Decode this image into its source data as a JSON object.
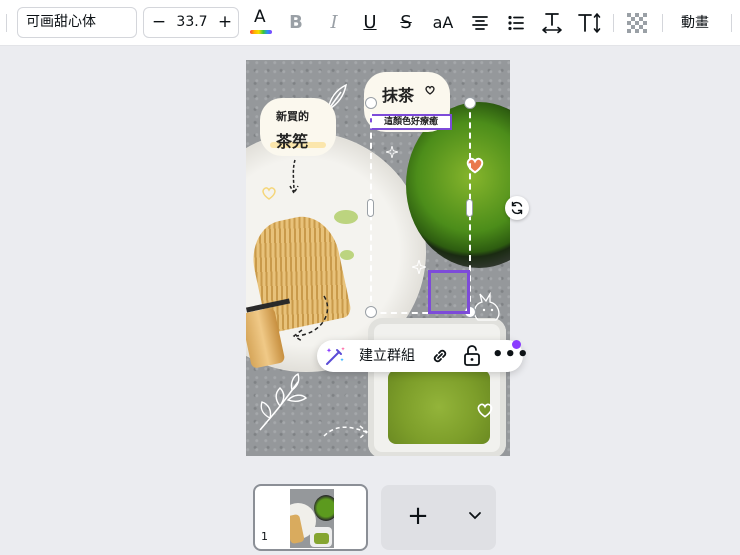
{
  "toolbar": {
    "font_name": "可画甜心体",
    "font_size": "33.7",
    "size_minus": "−",
    "size_plus": "+",
    "text_color_letter": "A",
    "bold_label": "B",
    "italic_label": "I",
    "underline_label": "U",
    "strike_label": "S",
    "case_label": "aA",
    "animate_label": "動畫"
  },
  "canvas": {
    "sticker_top_left_line1": "新買的",
    "sticker_top_left_line2": "茶筅",
    "sticker_top_right_title": "抹茶",
    "sticker_top_right_tag": "這顏色好療癒"
  },
  "context_menu": {
    "group_label": "建立群組",
    "more_label": "•••"
  },
  "pages": {
    "thumb_number": "1",
    "add_label": "+"
  },
  "colors": {
    "accent_purple": "#8b3dff",
    "selection_purple": "#7d4bd9",
    "toolbar_bg": "#ffffff",
    "workspace_bg": "#ebecf0"
  }
}
